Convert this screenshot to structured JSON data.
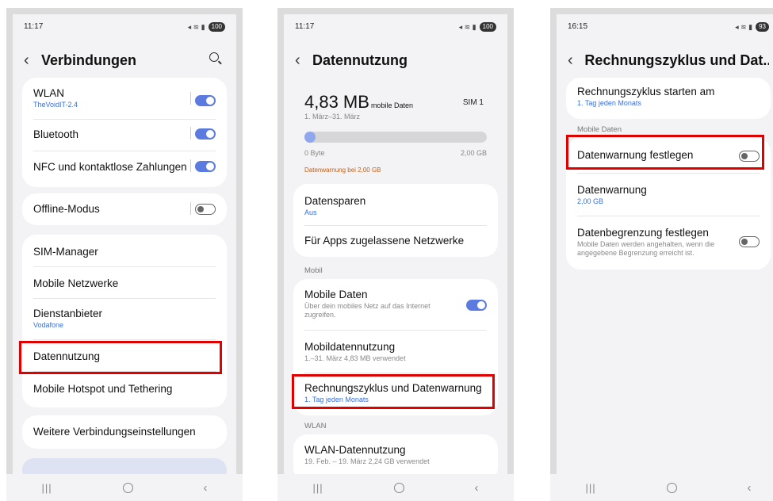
{
  "screens": [
    {
      "status": {
        "time": "11:17",
        "battery": "100"
      },
      "title": "Verbindungen",
      "groups": [
        [
          {
            "label": "WLAN",
            "sub": "TheVoidIT-2.4",
            "toggle": "on"
          },
          {
            "label": "Bluetooth",
            "toggle": "on"
          },
          {
            "label": "NFC und kontaktlose Zahlungen",
            "toggle": "on"
          }
        ],
        [
          {
            "label": "Offline-Modus",
            "toggle": "off"
          }
        ],
        [
          {
            "label": "SIM-Manager"
          },
          {
            "label": "Mobile Netzwerke"
          },
          {
            "label": "Dienstanbieter",
            "sub": "Vodafone"
          },
          {
            "label": "Datennutzung",
            "highlighted": true
          },
          {
            "label": "Mobile Hotspot und Tethering"
          }
        ],
        [
          {
            "label": "Weitere Verbindungseinstellungen"
          }
        ]
      ]
    },
    {
      "status": {
        "time": "11:17",
        "battery": "100"
      },
      "title": "Datennutzung",
      "usage": {
        "value": "4,83 MB",
        "unit": "mobile Daten",
        "sim": "SIM 1",
        "period": "1. März–31. März",
        "min": "0 Byte",
        "max": "2,00 GB",
        "warning": "Datenwarnung bei 2,00 GB",
        "fill_fraction": 0.03
      },
      "saver": [
        {
          "label": "Datensparen",
          "sub": "Aus"
        },
        {
          "label": "Für Apps zugelassene Netzwerke"
        }
      ],
      "section_mobile": "Mobil",
      "mobile": [
        {
          "label": "Mobile Daten",
          "desc": "Über dein mobiles Netz auf das Internet zugreifen.",
          "toggle": "on"
        },
        {
          "label": "Mobildatennutzung",
          "sub": "1.–31. März 4,83 MB verwendet"
        },
        {
          "label": "Rechnungszyklus und Datenwarnung",
          "sub": "1. Tag jeden Monats",
          "highlighted": true
        }
      ],
      "section_wlan": "WLAN",
      "wlan": [
        {
          "label": "WLAN-Datennutzung",
          "sub": "19. Feb. – 19. März 2,24 GB verwendet"
        }
      ]
    },
    {
      "status": {
        "time": "16:15",
        "battery": "93"
      },
      "title": "Rechnungszyklus und Dat...",
      "cycle": {
        "label": "Rechnungszyklus starten am",
        "sub": "1. Tag jeden Monats"
      },
      "section_mobile": "Mobile Daten",
      "items": [
        {
          "label": "Datenwarnung festlegen",
          "toggle": "off",
          "highlighted": true
        },
        {
          "label": "Datenwarnung",
          "sub": "2,00 GB"
        },
        {
          "label": "Datenbegrenzung festlegen",
          "desc": "Mobile Daten werden angehalten, wenn die angegebene Begrenzung erreicht ist.",
          "toggle": "off"
        }
      ]
    }
  ],
  "colors": {
    "accent": "#5b7be0",
    "highlight": "#e00000",
    "link": "#3a6fd8",
    "warning": "#c0601a"
  }
}
